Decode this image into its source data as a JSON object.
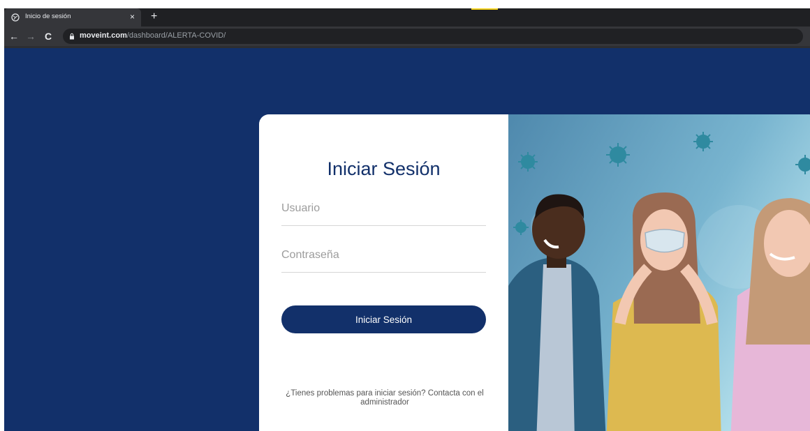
{
  "browser": {
    "tab": {
      "title": "Inicio de sesión",
      "close_symbol": "×",
      "new_tab_symbol": "+",
      "favicon_icon": "globe-icon"
    },
    "nav": {
      "back_symbol": "←",
      "forward_symbol": "→",
      "reload_symbol": "C"
    },
    "address": {
      "host": "moveint.com",
      "path": "/dashboard/ALERTA-COVID/",
      "lock_icon": "lock-icon"
    }
  },
  "login": {
    "title": "Iniciar Sesión",
    "username_placeholder": "Usuario",
    "password_placeholder": "Contraseña",
    "submit_label": "Iniciar Sesión",
    "help_text": "¿Tienes problemas para iniciar sesión? Contacta con el administrador"
  },
  "colors": {
    "page_background": "#12306a",
    "primary": "#12306a",
    "card_background": "#ffffff"
  }
}
